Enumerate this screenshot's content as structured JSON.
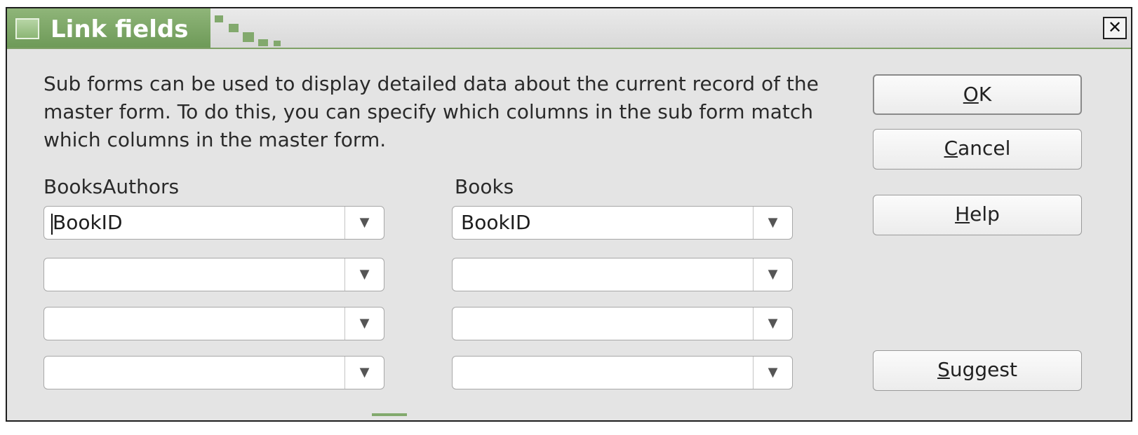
{
  "window": {
    "title": "Link fields"
  },
  "description": "Sub forms can be used to display detailed data about the current record of the master form. To do this, you can specify which columns in the sub form match which columns in the master form.",
  "columns": {
    "left_label": "BooksAuthors",
    "right_label": "Books"
  },
  "rows": [
    {
      "left_value": "BookID",
      "right_value": "BookID"
    },
    {
      "left_value": "",
      "right_value": ""
    },
    {
      "left_value": "",
      "right_value": ""
    },
    {
      "left_value": "",
      "right_value": ""
    }
  ],
  "buttons": {
    "ok": {
      "mnemonic": "O",
      "rest": "K"
    },
    "cancel": {
      "mnemonic": "C",
      "rest": "ancel"
    },
    "help": {
      "mnemonic": "H",
      "rest": "elp"
    },
    "suggest": {
      "mnemonic": "S",
      "rest": "uggest"
    }
  },
  "icons": {
    "close": "close-icon",
    "dropdown": "chevron-down-icon",
    "dropdown_glyph": "▼",
    "close_glyph": "✕"
  },
  "colors": {
    "titlebar_accent": "#7fa167",
    "dialog_bg": "#e4e4e4"
  }
}
